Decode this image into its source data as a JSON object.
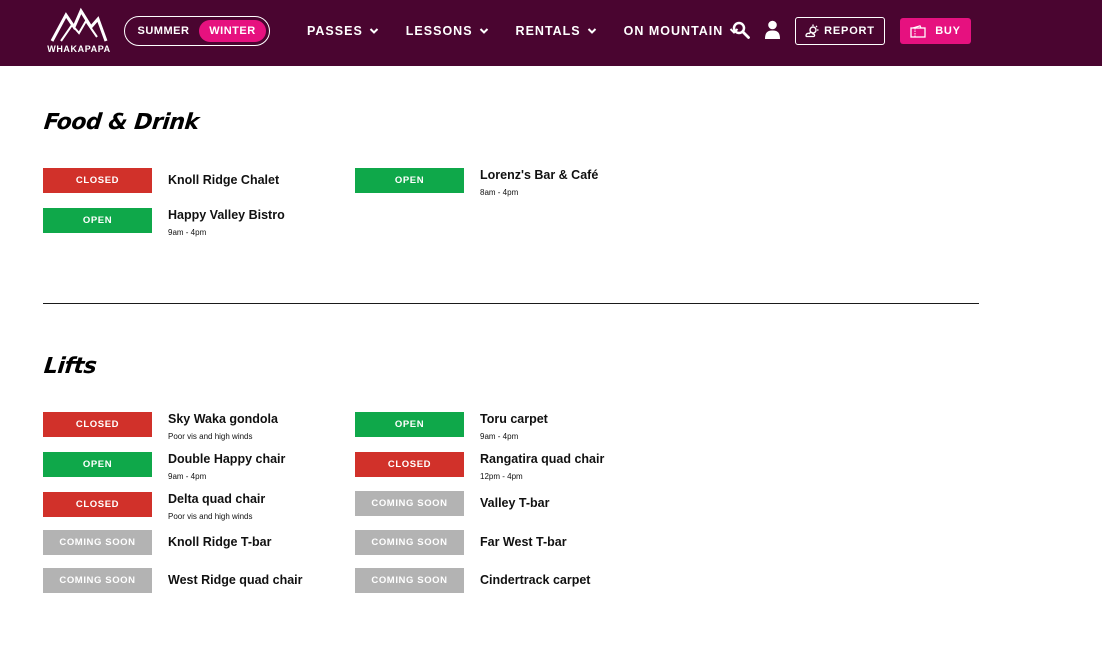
{
  "header": {
    "logo_text": "WHAKAPAPA",
    "season": {
      "summer": "SUMMER",
      "winter": "WINTER",
      "selected": "winter"
    },
    "nav": [
      "PASSES",
      "LESSONS",
      "RENTALS",
      "ON MOUNTAIN"
    ],
    "report_label": "REPORT",
    "buy_label": "BUY",
    "colors": {
      "bg": "#4a0530",
      "accent": "#e6117f"
    }
  },
  "status_colors": {
    "closed": "#d1312a",
    "open": "#0fa84a",
    "coming_soon": "#b3b3b3"
  },
  "food": {
    "title": "Food & Drink",
    "items": [
      {
        "status": "CLOSED",
        "name": "Knoll Ridge Chalet",
        "sub": ""
      },
      {
        "status": "OPEN",
        "name": "Lorenz's Bar & Café",
        "sub": "8am - 4pm"
      },
      {
        "status": "OPEN",
        "name": "Happy Valley Bistro",
        "sub": "9am - 4pm"
      }
    ]
  },
  "lifts": {
    "title": "Lifts",
    "items": [
      {
        "status": "CLOSED",
        "name": "Sky Waka gondola",
        "sub": "Poor vis and high winds"
      },
      {
        "status": "OPEN",
        "name": "Toru carpet",
        "sub": "9am - 4pm"
      },
      {
        "status": "OPEN",
        "name": "Double Happy chair",
        "sub": "9am - 4pm"
      },
      {
        "status": "CLOSED",
        "name": "Rangatira quad chair",
        "sub": "12pm - 4pm"
      },
      {
        "status": "CLOSED",
        "name": "Delta quad chair",
        "sub": "Poor vis and high winds"
      },
      {
        "status": "COMING SOON",
        "name": "Valley T-bar",
        "sub": ""
      },
      {
        "status": "COMING SOON",
        "name": "Knoll Ridge T-bar",
        "sub": ""
      },
      {
        "status": "COMING SOON",
        "name": "Far West T-bar",
        "sub": ""
      },
      {
        "status": "COMING SOON",
        "name": "West Ridge quad chair",
        "sub": ""
      },
      {
        "status": "COMING SOON",
        "name": "Cindertrack carpet",
        "sub": ""
      }
    ]
  }
}
